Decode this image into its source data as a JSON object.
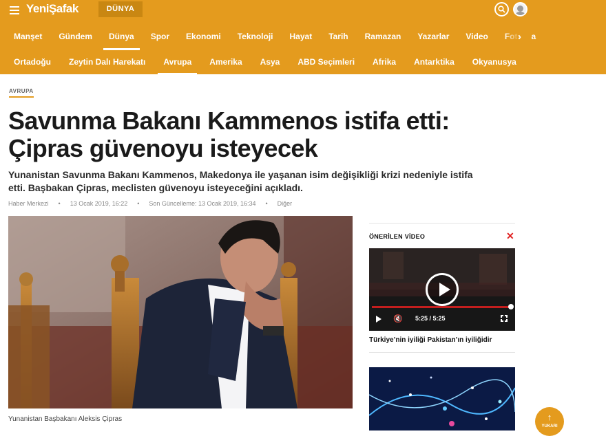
{
  "header": {
    "logo": "YeniŞafak",
    "section_badge": "DÜNYA",
    "icons": {
      "menu": "hamburger-icon",
      "search": "search-icon",
      "user": "user-avatar-icon"
    },
    "accent_color": "#e49b1e"
  },
  "main_nav": {
    "items": [
      "Manşet",
      "Gündem",
      "Dünya",
      "Spor",
      "Ekonomi",
      "Teknoloji",
      "Hayat",
      "Tarih",
      "Ramazan",
      "Yazarlar",
      "Video",
      "Foto Ga"
    ],
    "active": "Dünya"
  },
  "sub_nav": {
    "items": [
      "Ortadoğu",
      "Zeytin Dalı Harekatı",
      "Avrupa",
      "Amerika",
      "Asya",
      "ABD Seçimleri",
      "Afrika",
      "Antarktika",
      "Okyanusya"
    ],
    "active": "Avrupa"
  },
  "article": {
    "category": "AVRUPA",
    "headline": "Savunma Bakanı Kammenos istifa etti: Çipras güvenoyu isteyecek",
    "summary": "Yunanistan Savunma Bakanı Kammenos, Makedonya ile yaşanan isim değişikliği krizi nedeniyle istifa etti. Başbakan Çipras, meclisten güvenoyu isteyeceğini açıkladı.",
    "author": "Haber Merkezi",
    "published": "13 Ocak 2019, 16:22",
    "updated": "Son Güncelleme: 13 Ocak 2019, 16:34",
    "tag": "Diğer",
    "photo_caption": "Yunanistan Başbakanı Aleksis Çipras"
  },
  "sidebar": {
    "title": "ÖNERİLEN VİDEO",
    "video": {
      "time": "5:25  /  5:25",
      "title": "Türkiye’nin iyiliği Pakistan’ın iyiliğidir",
      "progress_fraction": 1.0
    }
  },
  "back_to_top": {
    "label": "YUKARI"
  }
}
